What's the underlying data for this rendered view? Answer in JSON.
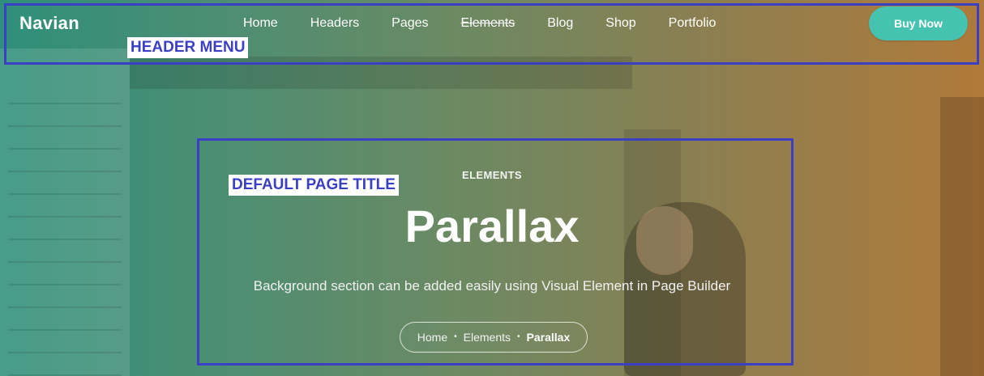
{
  "header": {
    "logo_text": "Navian",
    "nav": [
      {
        "label": "Home"
      },
      {
        "label": "Headers"
      },
      {
        "label": "Pages"
      },
      {
        "label": "Elements",
        "strikethrough": true
      },
      {
        "label": "Blog"
      },
      {
        "label": "Shop"
      },
      {
        "label": "Portfolio"
      }
    ],
    "cta_label": "Buy Now",
    "annotation_label": "HEADER MENU"
  },
  "title_section": {
    "annotation_label": "DEFAULT PAGE TITLE",
    "eyebrow": "ELEMENTS",
    "title": "Parallax",
    "subtitle": "Background section can be added easily using Visual Element in Page Builder",
    "breadcrumb": [
      "Home",
      "Elements",
      "Parallax"
    ],
    "breadcrumb_separator": "•"
  },
  "colors": {
    "accent": "#46c3b0",
    "annotation": "#3b3fc4",
    "text": "#ffffff"
  }
}
